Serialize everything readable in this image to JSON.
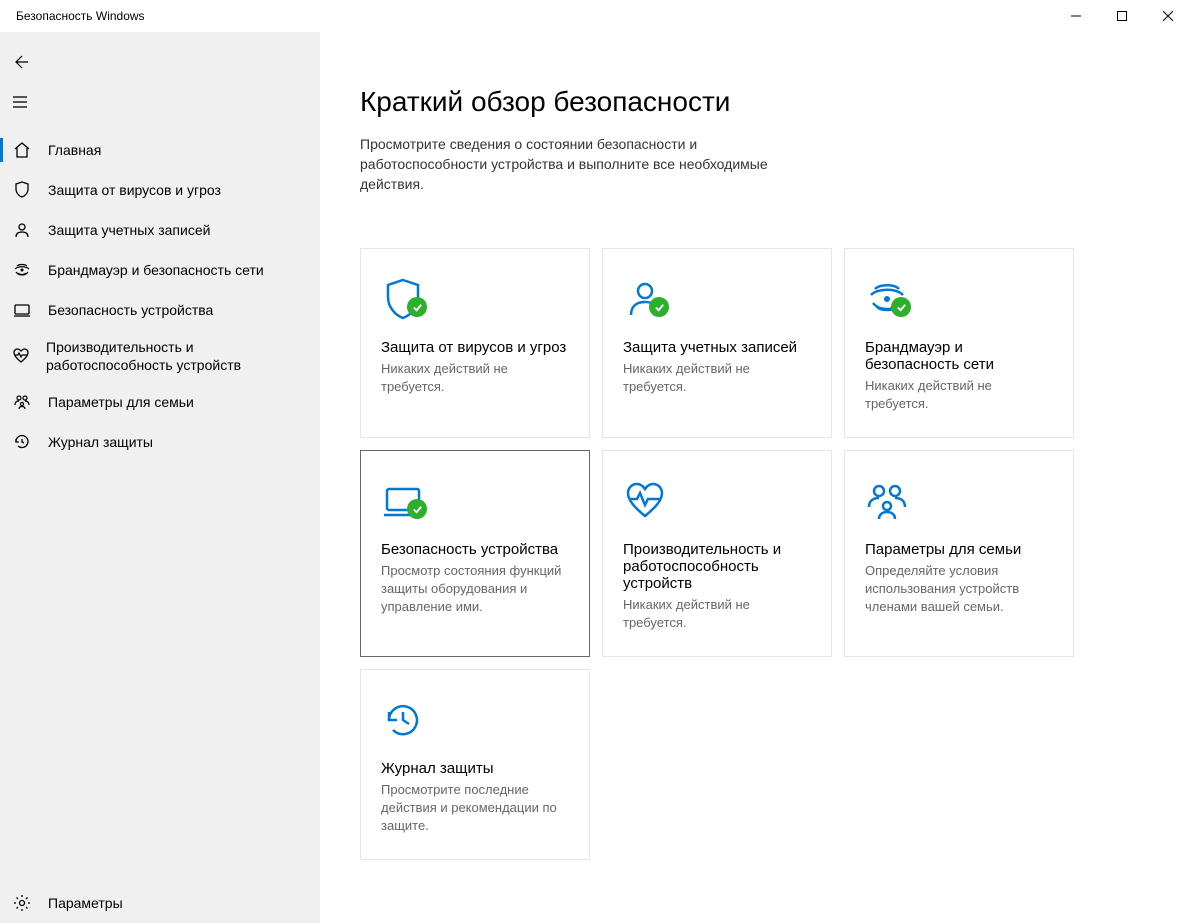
{
  "window": {
    "title": "Безопасность Windows"
  },
  "sidebar": {
    "items": [
      {
        "label": "Главная"
      },
      {
        "label": "Защита от вирусов и угроз"
      },
      {
        "label": "Защита учетных записей"
      },
      {
        "label": "Брандмауэр и безопасность сети"
      },
      {
        "label": "Безопасность устройства"
      },
      {
        "label": "Производительность и работоспособность устройств"
      },
      {
        "label": "Параметры для семьи"
      },
      {
        "label": "Журнал защиты"
      }
    ],
    "footer": {
      "label": "Параметры"
    }
  },
  "page": {
    "title": "Краткий обзор безопасности",
    "subtitle": "Просмотрите сведения о состоянии безопасности и работоспособности устройства и выполните все необходимые действия."
  },
  "cards": [
    {
      "title": "Защита от вирусов и угроз",
      "desc": "Никаких действий не требуется."
    },
    {
      "title": "Защита учетных записей",
      "desc": "Никаких действий не требуется."
    },
    {
      "title": "Брандмауэр и безопасность сети",
      "desc": "Никаких действий не требуется."
    },
    {
      "title": "Безопасность устройства",
      "desc": "Просмотр состояния функций защиты оборудования и управление ими."
    },
    {
      "title": "Производительность и работоспособность устройств",
      "desc": "Никаких действий не требуется."
    },
    {
      "title": "Параметры для семьи",
      "desc": "Определяйте условия использования устройств членами вашей семьи."
    },
    {
      "title": "Журнал защиты",
      "desc": "Просмотрите последние действия и рекомендации по защите."
    }
  ]
}
